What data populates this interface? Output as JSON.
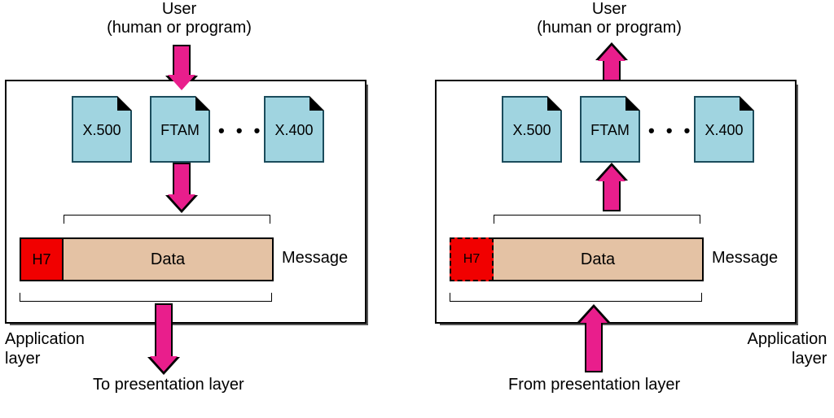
{
  "left": {
    "user_line1": "User",
    "user_line2": "(human or program)",
    "protocols": {
      "p1": "X.500",
      "p2": "FTAM",
      "p3": "X.400"
    },
    "header": "H7",
    "data": "Data",
    "message": "Message",
    "app_line1": "Application",
    "app_line2": "layer",
    "bottom": "To presentation layer"
  },
  "right": {
    "user_line1": "User",
    "user_line2": "(human or program)",
    "protocols": {
      "p1": "X.500",
      "p2": "FTAM",
      "p3": "X.400"
    },
    "header": "H7",
    "data": "Data",
    "message": "Message",
    "app_line1": "Application",
    "app_line2": "layer",
    "bottom": "From presentation layer"
  }
}
